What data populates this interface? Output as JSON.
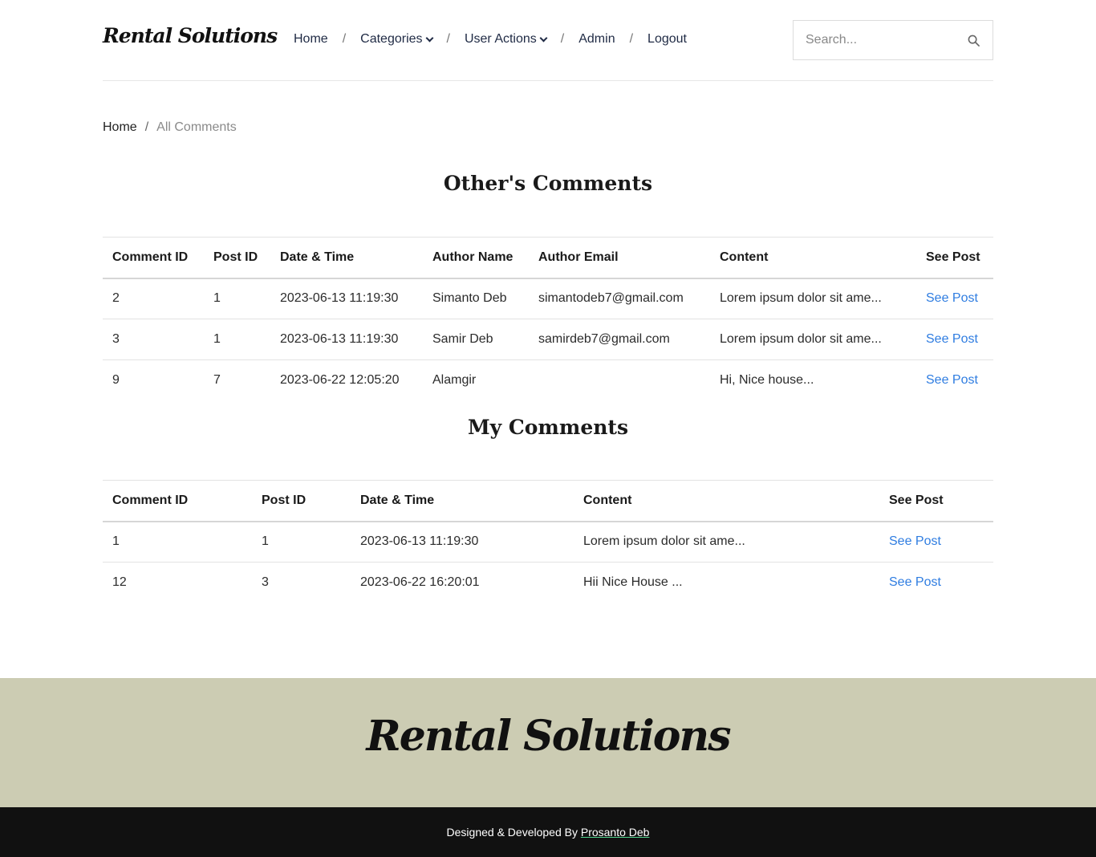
{
  "brand": {
    "logo_text": "Rental Solutions"
  },
  "nav": {
    "home": "Home",
    "categories": "Categories",
    "user_actions": "User Actions",
    "admin": "Admin",
    "logout": "Logout",
    "separator": "/"
  },
  "search": {
    "placeholder": "Search..."
  },
  "breadcrumb": {
    "home": "Home",
    "separator": "/",
    "current": "All Comments"
  },
  "others_comments": {
    "title": "Other's Comments",
    "headers": [
      "Comment ID",
      "Post ID",
      "Date & Time",
      "Author Name",
      "Author Email",
      "Content",
      "See Post"
    ],
    "rows": [
      {
        "comment_id": "2",
        "post_id": "1",
        "datetime": "2023-06-13 11:19:30",
        "author": "Simanto Deb",
        "email": "simantodeb7@gmail.com",
        "content": "Lorem ipsum dolor sit ame...",
        "link": "See Post"
      },
      {
        "comment_id": "3",
        "post_id": "1",
        "datetime": "2023-06-13 11:19:30",
        "author": "Samir Deb",
        "email": "samirdeb7@gmail.com",
        "content": "Lorem ipsum dolor sit ame...",
        "link": "See Post"
      },
      {
        "comment_id": "9",
        "post_id": "7",
        "datetime": "2023-06-22 12:05:20",
        "author": "Alamgir",
        "email": "",
        "content": "Hi, Nice house...",
        "link": "See Post"
      }
    ]
  },
  "my_comments": {
    "title": "My Comments",
    "headers": [
      "Comment ID",
      "Post ID",
      "Date & Time",
      "Content",
      "See Post"
    ],
    "rows": [
      {
        "comment_id": "1",
        "post_id": "1",
        "datetime": "2023-06-13 11:19:30",
        "content": "Lorem ipsum dolor sit ame...",
        "link": "See Post"
      },
      {
        "comment_id": "12",
        "post_id": "3",
        "datetime": "2023-06-22 16:20:01",
        "content": "Hii Nice House ...",
        "link": "See Post"
      }
    ]
  },
  "footer": {
    "logo_text": "Rental Solutions",
    "credit_prefix": "Designed & Developed By",
    "credit_name": "Prosanto Deb"
  },
  "colors": {
    "link": "#2f7de1",
    "footer_top_bg": "#ccccb3",
    "footer_bottom_bg": "#111111"
  },
  "icons": {
    "search": "search-icon",
    "chevron": "chevron-down-icon"
  }
}
